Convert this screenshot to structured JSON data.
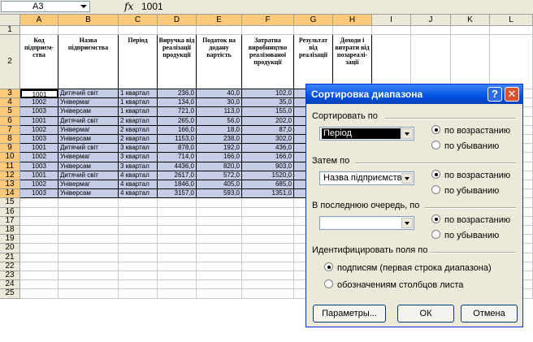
{
  "formula_bar": {
    "cell_ref": "A3",
    "fx": "fx",
    "value": "1001"
  },
  "columns": [
    "A",
    "B",
    "C",
    "D",
    "E",
    "F",
    "G",
    "H",
    "I",
    "J",
    "K",
    "L"
  ],
  "rows": [
    "1",
    "2",
    "3",
    "4",
    "5",
    "6",
    "7",
    "8",
    "9",
    "10",
    "11",
    "12",
    "13",
    "14",
    "15",
    "16",
    "17",
    "18",
    "19",
    "20",
    "21",
    "22",
    "23",
    "24",
    "25"
  ],
  "headers": [
    "Код підприєм-ства",
    "Назва підприємства",
    "Період",
    "Виручка від реалізації продукції",
    "Податок на додану вартість",
    "Затратна виробництво реалізованої продукції",
    "Результат від реалізації",
    "Доходи і витрати від позареалі-зації"
  ],
  "table": [
    [
      "1001",
      "Дитячий світ",
      "1 квартал",
      "236,0",
      "40,0",
      "102,0"
    ],
    [
      "1002",
      "Універмаг",
      "1 квартал",
      "134,0",
      "30,0",
      "35,0"
    ],
    [
      "1003",
      "Універсам",
      "1 квартал",
      "721,0",
      "113,0",
      "155,0"
    ],
    [
      "1001",
      "Дитячий світ",
      "2 квартал",
      "265,0",
      "56,0",
      "202,0"
    ],
    [
      "1002",
      "Універмаг",
      "2 квартал",
      "166,0",
      "18,0",
      "87,0"
    ],
    [
      "1003",
      "Універсам",
      "2 квартал",
      "1153,0",
      "238,0",
      "302,0"
    ],
    [
      "1001",
      "Дитячий світ",
      "3 квартал",
      "878,0",
      "192,0",
      "436,0"
    ],
    [
      "1002",
      "Універмаг",
      "3 квартал",
      "714,0",
      "166,0",
      "166,0"
    ],
    [
      "1003",
      "Універсам",
      "3 квартал",
      "4436,0",
      "820,0",
      "903,0"
    ],
    [
      "1001",
      "Дитячий світ",
      "4 квартал",
      "2617,0",
      "572,0",
      "1520,0"
    ],
    [
      "1002",
      "Універмаг",
      "4 квартал",
      "1846,0",
      "405,0",
      "685,0"
    ],
    [
      "1003",
      "Універсам",
      "4 квартал",
      "3157,0",
      "593,0",
      "1351,0"
    ]
  ],
  "dialog": {
    "title": "Сортировка диапазона",
    "help": "?",
    "close": "✕",
    "sort_by_label": "Сортировать по",
    "sort_by_value": "Період",
    "then_by_label": "Затем по",
    "then_by_value": "Назва підприємства",
    "last_by_label": "В последнюю очередь, по",
    "last_by_value": "",
    "asc": "по возрастанию",
    "desc": "по убыванию",
    "identify_label": "Идентифицировать поля по",
    "opt_labels": "подписям (первая строка диапазона)",
    "opt_columns": "обозначениям столбцов листа",
    "params_button": "Параметры...",
    "ok_button": "ОК",
    "cancel_button": "Отмена"
  },
  "colors": {
    "selection": "#c5cde6",
    "title_bar": "#0052e0",
    "header_sel": "#ffc97a"
  }
}
